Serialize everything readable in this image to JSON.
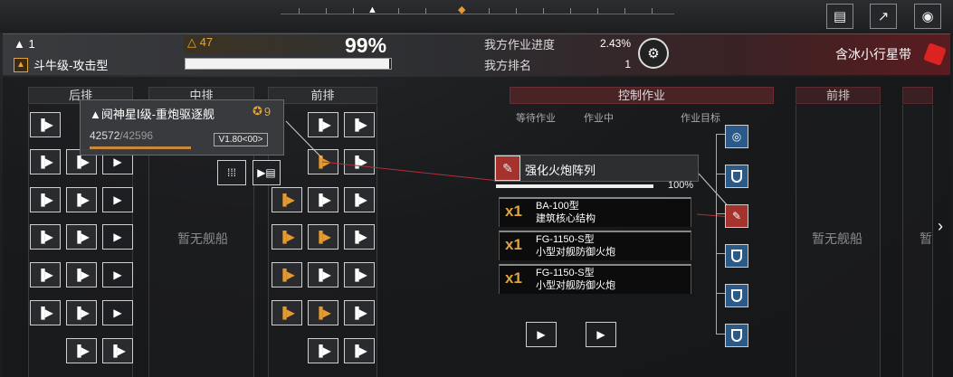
{
  "top": {
    "icons": [
      "screen-share-icon",
      "external-link-icon",
      "eye-icon"
    ],
    "markers": [
      "▲",
      "◆"
    ]
  },
  "header": {
    "rank": "▲ 1",
    "class_name": "斗牛级-攻击型",
    "level": "△ 47",
    "percent": "99%",
    "percent_value": 0.99,
    "progress_label": "我方作业进度",
    "progress_value": "2.43%",
    "rank_label": "我方排名",
    "rank_value": "1",
    "zone": "含冰小行星带",
    "zone_color": "#dd2222"
  },
  "formation": {
    "columns": [
      {
        "label": "后排"
      },
      {
        "label": "中排"
      },
      {
        "label": "前排"
      },
      {
        "label": "控制作业"
      },
      {
        "label": "前排"
      },
      {
        "label": ""
      }
    ],
    "sub_labels": [
      "等待作业",
      "作业中",
      "作业目标"
    ],
    "empty": [
      "暂无舰船",
      "暂无舰船",
      "暂"
    ],
    "slot_glyph": "▶"
  },
  "card": {
    "title": "▲阋神星Ⅰ级-重炮驱逐舰",
    "level": "9",
    "hp": "42572",
    "hp_max": "/42596",
    "hp_ratio": 0.9994,
    "version": "V1.80<00>"
  },
  "operation": {
    "title": "强化火炮阵列",
    "percent": "100%",
    "progress": 1.0,
    "items": [
      {
        "qty": "x1",
        "code": "BA-100型",
        "name": "建筑核心结构"
      },
      {
        "qty": "x1",
        "code": "FG-1150-S型",
        "name": "小型对舰防御火炮"
      },
      {
        "qty": "x1",
        "code": "FG-1150-S型",
        "name": "小型对舰防御火炮"
      }
    ]
  },
  "nav": {
    "next": "›"
  }
}
